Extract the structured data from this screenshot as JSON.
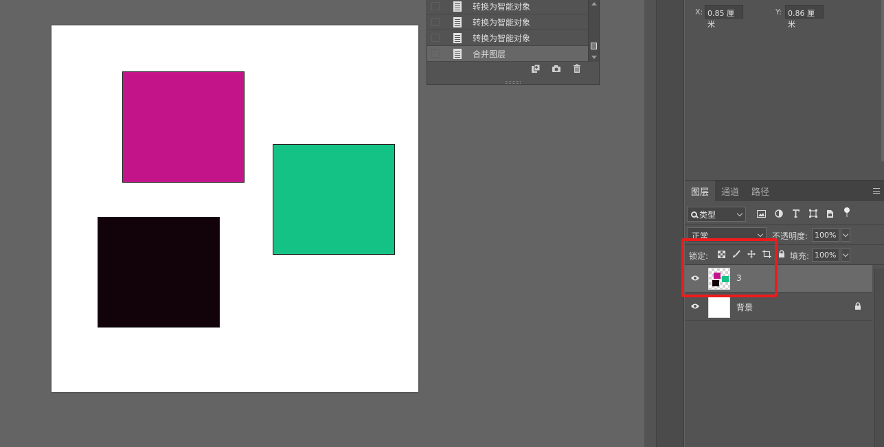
{
  "canvas": {
    "shapes": [
      {
        "name": "magenta-square",
        "color": "#c4148a"
      },
      {
        "name": "green-square",
        "color": "#14c285"
      },
      {
        "name": "black-square",
        "color": "#12020a"
      }
    ]
  },
  "history": {
    "items": [
      {
        "label": "转换为智能对象",
        "selected": false
      },
      {
        "label": "转换为智能对象",
        "selected": false
      },
      {
        "label": "转换为智能对象",
        "selected": false
      },
      {
        "label": "合并图层",
        "selected": true
      }
    ],
    "tools": [
      "new-document-icon",
      "snapshot-camera-icon",
      "trash-icon"
    ]
  },
  "properties": {
    "x_label": "X:",
    "x_value": "0.85 厘米",
    "y_label": "Y:",
    "y_value": "0.86 厘米"
  },
  "layers_panel": {
    "tabs": [
      {
        "label": "图层",
        "active": true
      },
      {
        "label": "通道",
        "active": false
      },
      {
        "label": "路径",
        "active": false
      }
    ],
    "filter_kind": "类型",
    "filter_icons": [
      "image-filter-icon",
      "adjustment-filter-icon",
      "type-filter-icon",
      "shape-filter-icon",
      "smart-object-filter-icon"
    ],
    "blend_mode": "正常",
    "opacity_label": "不透明度:",
    "opacity_value": "100%",
    "lock_label": "锁定:",
    "lock_icons": [
      "lock-transparent-icon",
      "lock-paint-icon",
      "lock-position-icon",
      "lock-artboard-icon",
      "lock-all-icon"
    ],
    "fill_label": "填充:",
    "fill_value": "100%",
    "layers": [
      {
        "name": "3",
        "selected": true,
        "visible": true,
        "locked": false
      },
      {
        "name": "背景",
        "selected": false,
        "visible": true,
        "locked": true
      }
    ]
  },
  "annotation": {
    "highlight_color": "#ef1b1b"
  }
}
